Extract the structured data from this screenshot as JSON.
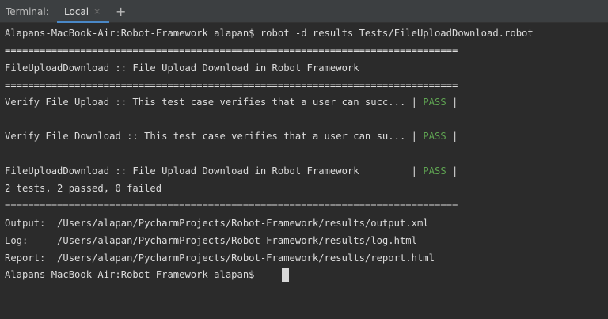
{
  "toolbar": {
    "label": "Terminal:",
    "tab_label": "Local",
    "close_icon": "×",
    "new_tab_icon": "+"
  },
  "terminal": {
    "prompt_command": "Alapans-MacBook-Air:Robot-Framework alapan$ robot -d results Tests/FileUploadDownload.robot",
    "sep_eq_1": "==============================================================================",
    "suite_header": "FileUploadDownload :: File Upload Download in Robot Framework",
    "sep_eq_2": "==============================================================================",
    "test1_text": "Verify File Upload :: This test case verifies that a user can succ... | ",
    "test1_status": "PASS",
    "test1_end": " |",
    "sep_dash_1": "------------------------------------------------------------------------------",
    "test2_text": "Verify File Download :: This test case verifies that a user can su... | ",
    "test2_status": "PASS",
    "test2_end": " |",
    "sep_dash_2": "------------------------------------------------------------------------------",
    "suite_result_text": "FileUploadDownload :: File Upload Download in Robot Framework         | ",
    "suite_result_status": "PASS",
    "suite_result_end": " |",
    "stats": "2 tests, 2 passed, 0 failed",
    "sep_eq_3": "==============================================================================",
    "output_line": "Output:  /Users/alapan/PycharmProjects/Robot-Framework/results/output.xml",
    "log_line": "Log:     /Users/alapan/PycharmProjects/Robot-Framework/results/log.html",
    "report_line": "Report:  /Users/alapan/PycharmProjects/Robot-Framework/results/report.html",
    "final_prompt": "Alapans-MacBook-Air:Robot-Framework alapan$ "
  },
  "colors": {
    "background": "#2b2b2b",
    "text": "#dcdcdc",
    "pass": "#5fa452",
    "tab_underline": "#4a88c7"
  },
  "icons": {
    "close": "close-icon",
    "new_tab": "plus-icon"
  }
}
